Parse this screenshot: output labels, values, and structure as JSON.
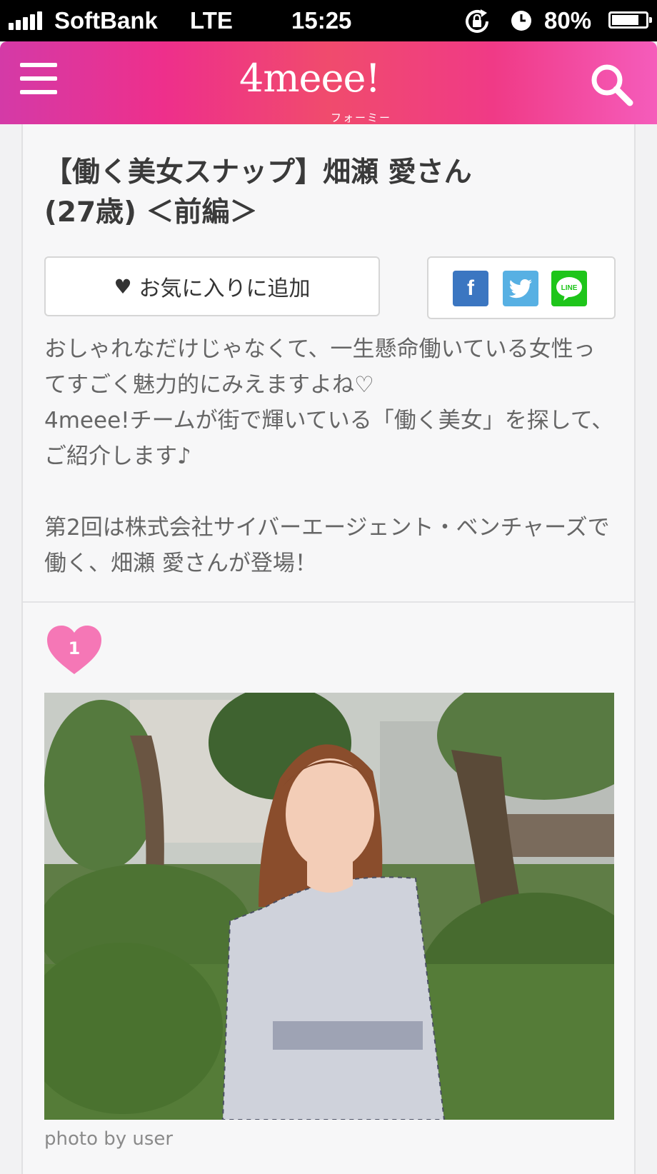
{
  "status_bar": {
    "carrier": "SoftBank",
    "network": "LTE",
    "time": "15:25",
    "battery": "80%",
    "battery_level": 0.8
  },
  "header": {
    "logo": "4meee!",
    "logo_kana": "フォーミー"
  },
  "article": {
    "title_line1": "【働く美女スナップ】畑瀬 愛さん",
    "title_line2": "(27歳) ＜前編＞",
    "favorite_button": "お気に入りに追加",
    "share": {
      "facebook": "f",
      "line": "LINE"
    },
    "intro": [
      "おしゃれなだけじゃなくて、一生懸命働いている女性ってすごく魅力的にみえますよね♡",
      "4meee!チームが街で輝いている「働く美女」を探して、ご紹介します♪"
    ],
    "intro2": "第2回は株式会社サイバーエージェント・ベンチャーズで働く、畑瀬 愛さんが登場！",
    "rank_number": "1",
    "photo_credit": "photo by user"
  },
  "colors": {
    "brand_pink": "#ee2f8b",
    "facebook": "#3b76c1",
    "twitter": "#57b0e3",
    "line": "#1ec51a",
    "rank_heart": "#f577b6"
  },
  "icons": [
    "signal-icon",
    "rotation-lock-icon",
    "alarm-icon",
    "battery-icon",
    "menu-icon",
    "search-icon",
    "heart-icon",
    "facebook-icon",
    "twitter-icon",
    "line-icon",
    "rank-heart-icon"
  ]
}
